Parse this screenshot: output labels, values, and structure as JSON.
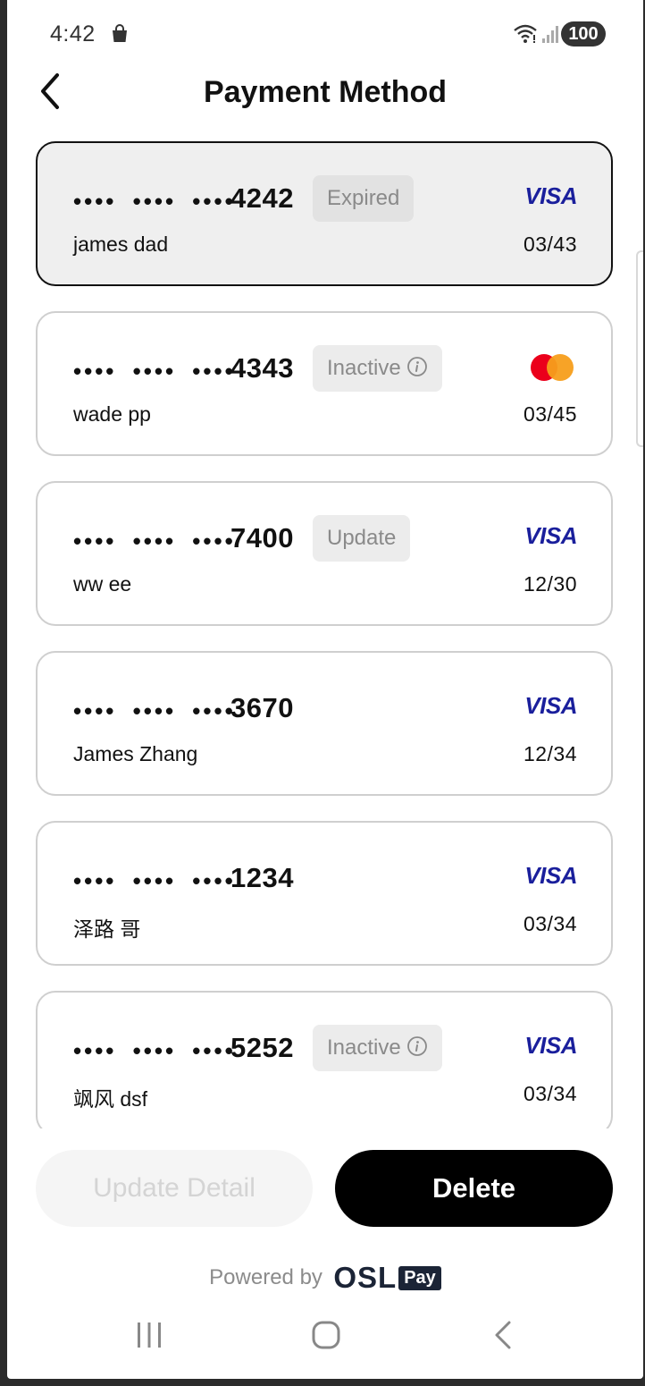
{
  "status_bar": {
    "time": "4:42",
    "battery": "100"
  },
  "header": {
    "title": "Payment Method"
  },
  "cards": [
    {
      "dots": "•••• •••• ••••",
      "last4": "4242",
      "status": "Expired",
      "has_info": false,
      "holder": "james dad",
      "expiry": "03/43",
      "brand": "VISA",
      "brand_icon": "visa-logo",
      "selected": true
    },
    {
      "dots": "•••• •••• ••••",
      "last4": "4343",
      "status": "Inactive",
      "has_info": true,
      "holder": "wade pp",
      "expiry": "03/45",
      "brand": "",
      "brand_icon": "mastercard-logo",
      "selected": false
    },
    {
      "dots": "•••• •••• ••••",
      "last4": "7400",
      "status": "Update",
      "has_info": false,
      "holder": "ww ee",
      "expiry": "12/30",
      "brand": "VISA",
      "brand_icon": "visa-logo",
      "selected": false
    },
    {
      "dots": "•••• •••• ••••",
      "last4": "3670",
      "status": "",
      "has_info": false,
      "holder": "James Zhang",
      "expiry": "12/34",
      "brand": "VISA",
      "brand_icon": "visa-logo",
      "selected": false
    },
    {
      "dots": "•••• •••• ••••",
      "last4": "1234",
      "status": "",
      "has_info": false,
      "holder": "泽路 哥",
      "expiry": "03/34",
      "brand": "VISA",
      "brand_icon": "visa-logo",
      "selected": false
    },
    {
      "dots": "•••• •••• ••••",
      "last4": "5252",
      "status": "Inactive",
      "has_info": true,
      "holder": "飒风 dsf",
      "expiry": "03/34",
      "brand": "VISA",
      "brand_icon": "visa-logo",
      "selected": false
    }
  ],
  "actions": {
    "update_label": "Update Detail",
    "delete_label": "Delete"
  },
  "footer": {
    "powered_by": "Powered by",
    "brand": "OSL",
    "brand_badge": "Pay"
  },
  "colors": {
    "visa_blue": "#1a1f9c",
    "mastercard_red": "#eb001b",
    "mastercard_orange": "#f79e1b",
    "primary_button": "#000000"
  }
}
